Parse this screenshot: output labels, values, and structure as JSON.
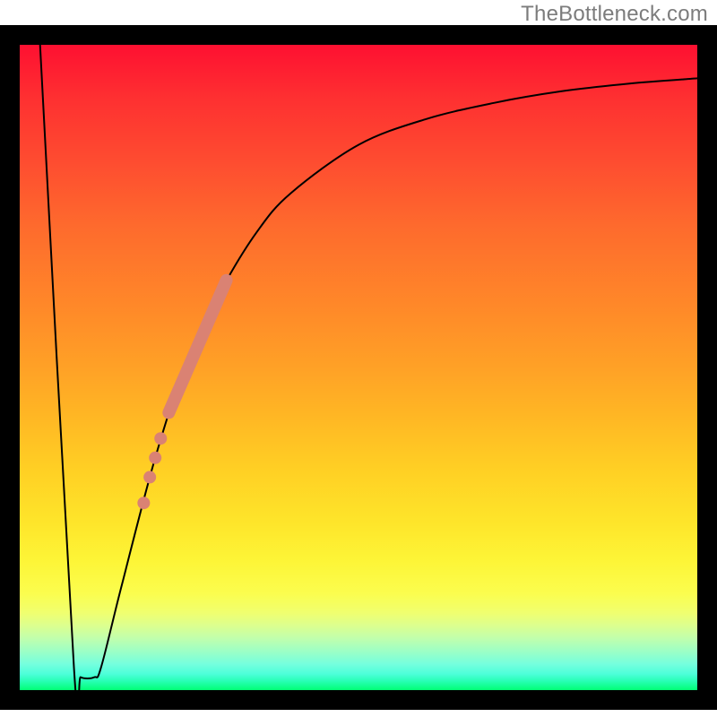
{
  "attribution": "TheBottleneck.com",
  "chart_data": {
    "type": "line",
    "title": "",
    "xlabel": "",
    "ylabel": "",
    "xlim": [
      0,
      100
    ],
    "ylim": [
      0,
      100
    ],
    "grid": false,
    "legend": false,
    "series": [
      {
        "name": "bottleneck-curve",
        "points": [
          {
            "x": 3.0,
            "y": 100.0
          },
          {
            "x": 8.0,
            "y": 3.5
          },
          {
            "x": 9.0,
            "y": 2.0
          },
          {
            "x": 11.0,
            "y": 2.0
          },
          {
            "x": 12.0,
            "y": 3.5
          },
          {
            "x": 15.0,
            "y": 16.0
          },
          {
            "x": 20.0,
            "y": 36.0
          },
          {
            "x": 25.0,
            "y": 52.0
          },
          {
            "x": 30.0,
            "y": 62.5
          },
          {
            "x": 35.0,
            "y": 71.0
          },
          {
            "x": 40.0,
            "y": 77.0
          },
          {
            "x": 50.0,
            "y": 84.5
          },
          {
            "x": 60.0,
            "y": 88.5
          },
          {
            "x": 70.0,
            "y": 91.0
          },
          {
            "x": 80.0,
            "y": 92.8
          },
          {
            "x": 90.0,
            "y": 94.0
          },
          {
            "x": 100.0,
            "y": 94.8
          }
        ]
      }
    ],
    "highlight_band": {
      "name": "highlight-segment",
      "start": {
        "x": 22.0,
        "y": 43.0
      },
      "end": {
        "x": 30.5,
        "y": 63.5
      }
    },
    "highlight_points": [
      {
        "x": 20.0,
        "y": 36.0
      },
      {
        "x": 20.8,
        "y": 39.0
      },
      {
        "x": 19.2,
        "y": 33.0
      },
      {
        "x": 18.3,
        "y": 29.0
      }
    ]
  }
}
